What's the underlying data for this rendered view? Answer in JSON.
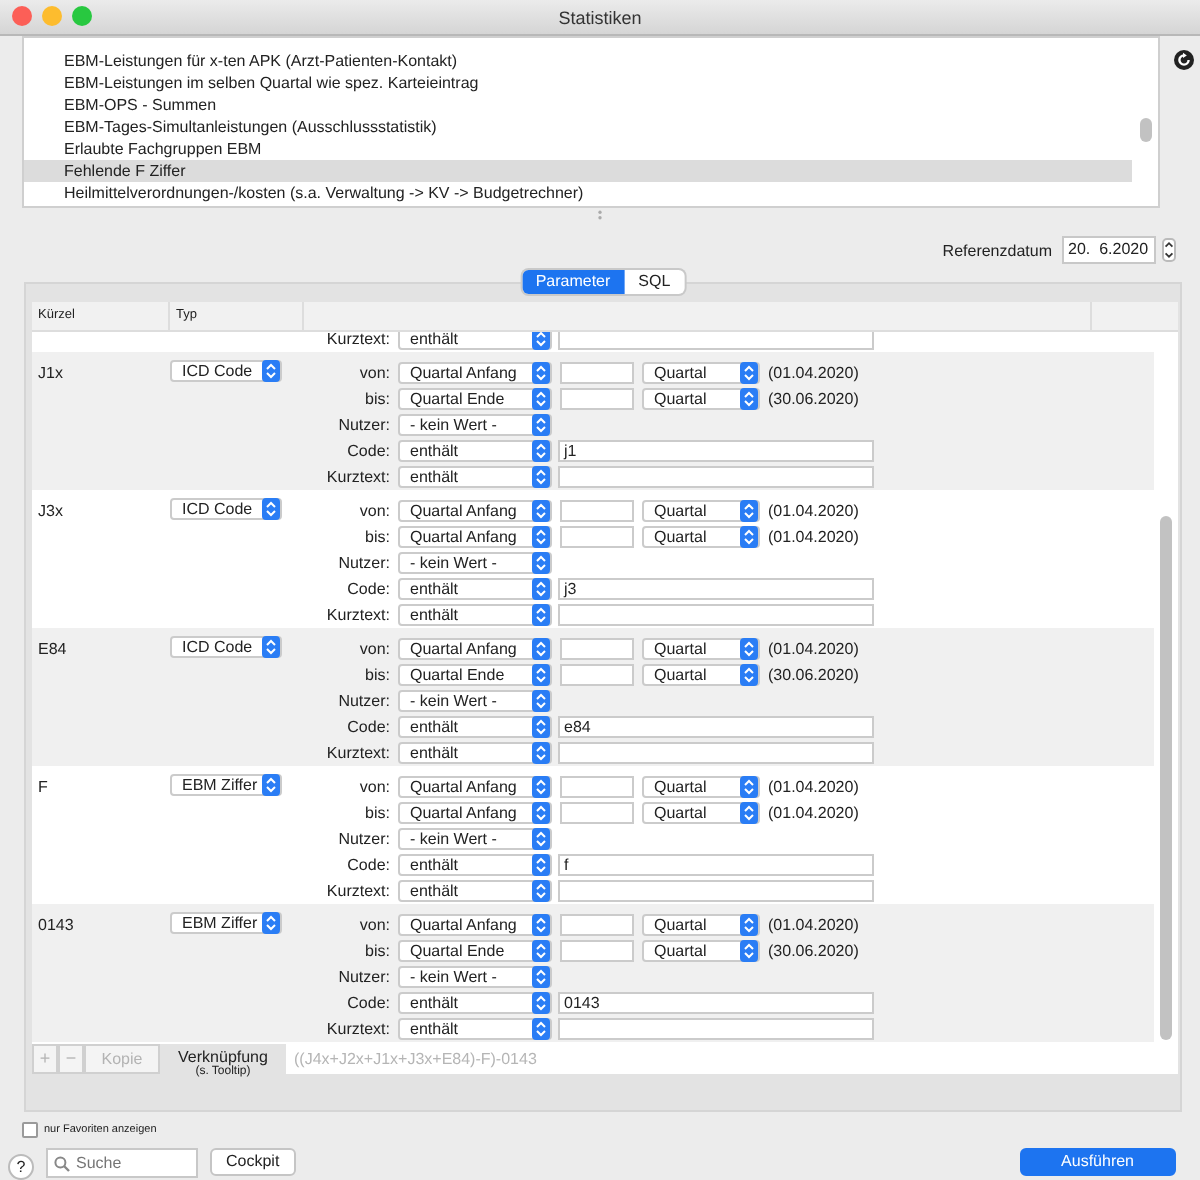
{
  "window": {
    "title": "Statistiken"
  },
  "statistics_list": {
    "items": [
      {
        "label": "EBM-Leistungen für x-ten APK (Arzt-Patienten-Kontakt)",
        "selected": false
      },
      {
        "label": "EBM-Leistungen im selben Quartal wie spez. Karteieintrag",
        "selected": false
      },
      {
        "label": "EBM-OPS - Summen",
        "selected": false
      },
      {
        "label": "EBM-Tages-Simultanleistungen (Ausschlussstatistik)",
        "selected": false
      },
      {
        "label": "Erlaubte Fachgruppen EBM",
        "selected": false
      },
      {
        "label": "Fehlende F Ziffer",
        "selected": true
      },
      {
        "label": "Heilmittelverordnungen-/kosten (s.a. Verwaltung -> KV -> Budgetrechner)",
        "selected": false
      }
    ]
  },
  "reference_date": {
    "label": "Referenzdatum",
    "value": "20.  6.2020"
  },
  "tabs": [
    {
      "label": "Parameter",
      "selected": true
    },
    {
      "label": "SQL",
      "selected": false
    }
  ],
  "table": {
    "columns": [
      "Kürzel",
      "Typ"
    ],
    "rows": [
      {
        "params": [
          {
            "kind": "match",
            "label": "Kurztext:",
            "op": "enthält"
          }
        ]
      },
      {
        "kuerzel": "J1x",
        "typ": "ICD Code",
        "params": [
          {
            "kind": "range",
            "label": "von:",
            "mode": "Quartal Anfang",
            "unit": "Quartal",
            "date": "(01.04.2020)"
          },
          {
            "kind": "range",
            "label": "bis:",
            "mode": "Quartal Ende",
            "unit": "Quartal",
            "date": "(30.06.2020)"
          },
          {
            "kind": "select",
            "label": "Nutzer:",
            "value": "- kein Wert -"
          },
          {
            "kind": "match",
            "label": "Code:",
            "op": "enthält",
            "value": "j1"
          },
          {
            "kind": "match",
            "label": "Kurztext:",
            "op": "enthält"
          }
        ]
      },
      {
        "kuerzel": "J3x",
        "typ": "ICD Code",
        "params": [
          {
            "kind": "range",
            "label": "von:",
            "mode": "Quartal Anfang",
            "unit": "Quartal",
            "date": "(01.04.2020)"
          },
          {
            "kind": "range",
            "label": "bis:",
            "mode": "Quartal Anfang",
            "unit": "Quartal",
            "date": "(01.04.2020)"
          },
          {
            "kind": "select",
            "label": "Nutzer:",
            "value": "- kein Wert -"
          },
          {
            "kind": "match",
            "label": "Code:",
            "op": "enthält",
            "value": "j3"
          },
          {
            "kind": "match",
            "label": "Kurztext:",
            "op": "enthält"
          }
        ]
      },
      {
        "kuerzel": "E84",
        "typ": "ICD Code",
        "params": [
          {
            "kind": "range",
            "label": "von:",
            "mode": "Quartal Anfang",
            "unit": "Quartal",
            "date": "(01.04.2020)"
          },
          {
            "kind": "range",
            "label": "bis:",
            "mode": "Quartal Ende",
            "unit": "Quartal",
            "date": "(30.06.2020)"
          },
          {
            "kind": "select",
            "label": "Nutzer:",
            "value": "- kein Wert -"
          },
          {
            "kind": "match",
            "label": "Code:",
            "op": "enthält",
            "value": "e84"
          },
          {
            "kind": "match",
            "label": "Kurztext:",
            "op": "enthält"
          }
        ]
      },
      {
        "kuerzel": "F",
        "typ": "EBM Ziffer",
        "params": [
          {
            "kind": "range",
            "label": "von:",
            "mode": "Quartal Anfang",
            "unit": "Quartal",
            "date": "(01.04.2020)"
          },
          {
            "kind": "range",
            "label": "bis:",
            "mode": "Quartal Anfang",
            "unit": "Quartal",
            "date": "(01.04.2020)"
          },
          {
            "kind": "select",
            "label": "Nutzer:",
            "value": "- kein Wert -"
          },
          {
            "kind": "match",
            "label": "Code:",
            "op": "enthält",
            "value": "f"
          },
          {
            "kind": "match",
            "label": "Kurztext:",
            "op": "enthält"
          }
        ]
      },
      {
        "kuerzel": "0143",
        "typ": "EBM Ziffer",
        "params": [
          {
            "kind": "range",
            "label": "von:",
            "mode": "Quartal Anfang",
            "unit": "Quartal",
            "date": "(01.04.2020)"
          },
          {
            "kind": "range",
            "label": "bis:",
            "mode": "Quartal Ende",
            "unit": "Quartal",
            "date": "(30.06.2020)"
          },
          {
            "kind": "select",
            "label": "Nutzer:",
            "value": "- kein Wert -"
          },
          {
            "kind": "match",
            "label": "Code:",
            "op": "enthält",
            "value": "0143"
          },
          {
            "kind": "match",
            "label": "Kurztext:",
            "op": "enthält"
          }
        ]
      }
    ]
  },
  "toolbar": {
    "add": {
      "label": "+",
      "disabled": true
    },
    "remove": {
      "label": "−",
      "disabled": true
    },
    "copy": {
      "label": "Kopie",
      "disabled": true
    },
    "link_label": "Verknüpfung",
    "link_hint": "(s. Tooltip)",
    "formula": "((J4x+J2x+J1x+J3x+E84)-F)-0143"
  },
  "favorites_only": {
    "label": "nur Favoriten anzeigen",
    "checked": false
  },
  "search": {
    "placeholder": "Suche"
  },
  "buttons": {
    "help": "?",
    "cockpit": "Cockpit",
    "run": "Ausführen"
  }
}
